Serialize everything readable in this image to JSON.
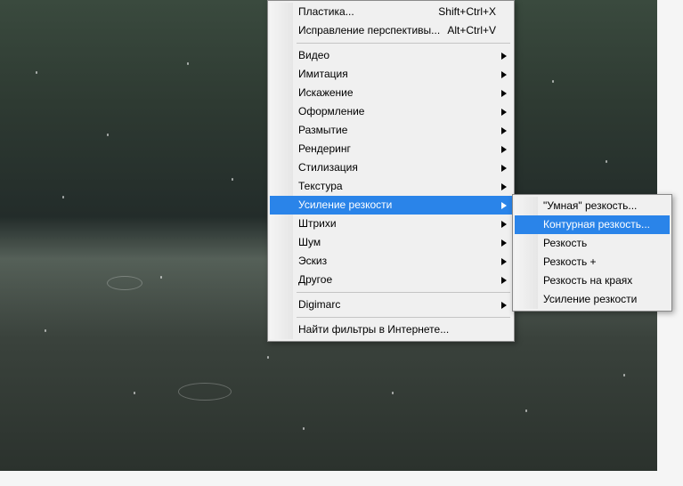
{
  "colors": {
    "highlight": "#2a84e9"
  },
  "menu": {
    "blocks": [
      [
        {
          "label": "Пластика...",
          "shortcut": "Shift+Ctrl+X",
          "submenu": false,
          "highlight": false
        },
        {
          "label": "Исправление перспективы...",
          "shortcut": "Alt+Ctrl+V",
          "submenu": false,
          "highlight": false
        }
      ],
      [
        {
          "label": "Видео",
          "shortcut": "",
          "submenu": true,
          "highlight": false
        },
        {
          "label": "Имитация",
          "shortcut": "",
          "submenu": true,
          "highlight": false
        },
        {
          "label": "Искажение",
          "shortcut": "",
          "submenu": true,
          "highlight": false
        },
        {
          "label": "Оформление",
          "shortcut": "",
          "submenu": true,
          "highlight": false
        },
        {
          "label": "Размытие",
          "shortcut": "",
          "submenu": true,
          "highlight": false
        },
        {
          "label": "Рендеринг",
          "shortcut": "",
          "submenu": true,
          "highlight": false
        },
        {
          "label": "Стилизация",
          "shortcut": "",
          "submenu": true,
          "highlight": false
        },
        {
          "label": "Текстура",
          "shortcut": "",
          "submenu": true,
          "highlight": false
        },
        {
          "label": "Усиление резкости",
          "shortcut": "",
          "submenu": true,
          "highlight": true
        },
        {
          "label": "Штрихи",
          "shortcut": "",
          "submenu": true,
          "highlight": false
        },
        {
          "label": "Шум",
          "shortcut": "",
          "submenu": true,
          "highlight": false
        },
        {
          "label": "Эскиз",
          "shortcut": "",
          "submenu": true,
          "highlight": false
        },
        {
          "label": "Другое",
          "shortcut": "",
          "submenu": true,
          "highlight": false
        }
      ],
      [
        {
          "label": "Digimarc",
          "shortcut": "",
          "submenu": true,
          "highlight": false
        }
      ],
      [
        {
          "label": "Найти фильтры в Интернете...",
          "shortcut": "",
          "submenu": false,
          "highlight": false
        }
      ]
    ]
  },
  "submenu": {
    "items": [
      {
        "label": "\"Умная\" резкость...",
        "highlight": false
      },
      {
        "label": "Контурная резкость...",
        "highlight": true
      },
      {
        "label": "Резкость",
        "highlight": false
      },
      {
        "label": "Резкость +",
        "highlight": false
      },
      {
        "label": "Резкость на краях",
        "highlight": false
      },
      {
        "label": "Усиление резкости",
        "highlight": false
      }
    ]
  }
}
